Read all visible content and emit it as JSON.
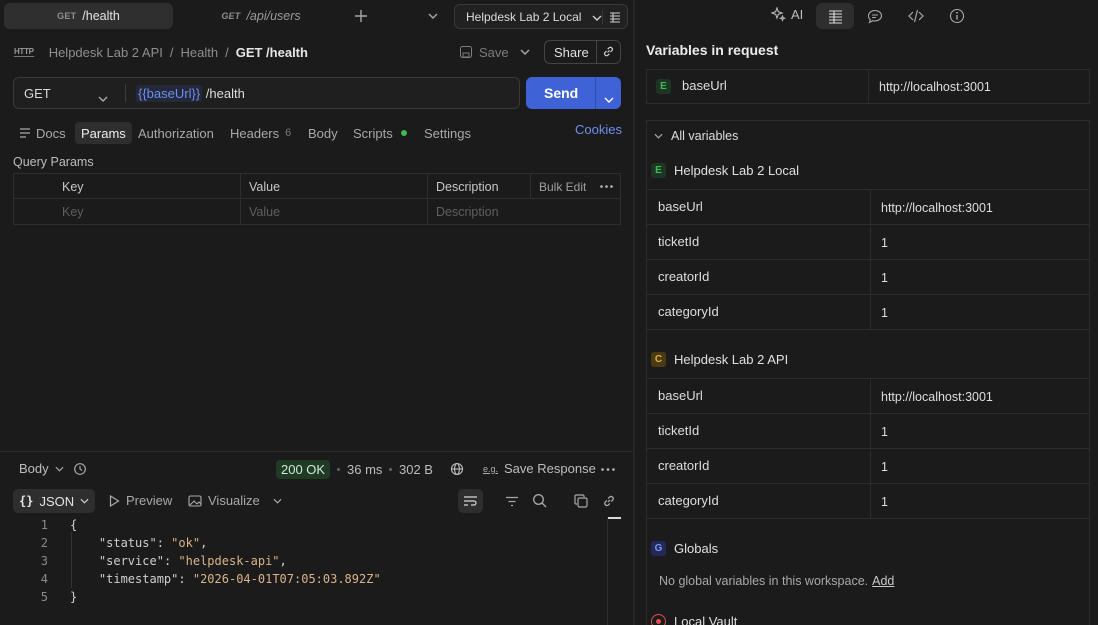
{
  "tabs": [
    {
      "method": "GET",
      "label": "GET /health",
      "active": true
    },
    {
      "method": "GET",
      "label": "GET /api/users",
      "active": false
    }
  ],
  "environment": {
    "selected": "Helpdesk Lab 2 Local"
  },
  "right_toolbar": {
    "ai_label": "AI"
  },
  "breadcrumb": {
    "collection": "Helpdesk Lab 2 API",
    "folder": "Health",
    "request": "GET /health"
  },
  "actions": {
    "save_label": "Save",
    "share_label": "Share"
  },
  "request": {
    "method": "GET",
    "url_variable": "{{baseUrl}}",
    "url_path": " /health",
    "send_label": "Send"
  },
  "request_tabs": [
    {
      "label": "Docs",
      "active": false
    },
    {
      "label": "Params",
      "active": true
    },
    {
      "label": "Authorization",
      "active": false
    },
    {
      "label": "Headers",
      "count": "6",
      "active": false
    },
    {
      "label": "Body",
      "active": false
    },
    {
      "label": "Scripts",
      "active": false
    },
    {
      "label": "Settings",
      "active": false
    }
  ],
  "cookies_label": "Cookies",
  "query_params": {
    "title": "Query Params",
    "headers": {
      "key": "Key",
      "value": "Value",
      "description": "Description",
      "bulk_edit": "Bulk Edit"
    },
    "placeholders": {
      "key": "Key",
      "value": "Value",
      "description": "Description"
    }
  },
  "response": {
    "body_label": "Body",
    "status": "200 OK",
    "time": "36 ms",
    "size": "302 B",
    "save_response_label": "Save Response",
    "format_label": "JSON",
    "preview_label": "Preview",
    "visualize_label": "Visualize",
    "lines": [
      {
        "n": "1",
        "text": "{"
      },
      {
        "n": "2",
        "key": "\"status\"",
        "value": "\"ok\"",
        "trail": ","
      },
      {
        "n": "3",
        "key": "\"service\"",
        "value": "\"helpdesk-api\"",
        "trail": ","
      },
      {
        "n": "4",
        "key": "\"timestamp\"",
        "value": "\"2026-04-01T07:05:03.892Z\"",
        "trail": ""
      },
      {
        "n": "5",
        "text": "}"
      }
    ]
  },
  "variables_panel": {
    "title": "Variables in request",
    "request_var": {
      "badge": "E",
      "name": "baseUrl",
      "value": "http://localhost:3001"
    },
    "all_variables_label": "All variables",
    "groups": [
      {
        "badge": "E",
        "name": "Helpdesk Lab 2 Local",
        "vars": [
          {
            "name": "baseUrl",
            "value": "http://localhost:3001"
          },
          {
            "name": "ticketId",
            "value": "1"
          },
          {
            "name": "creatorId",
            "value": "1"
          },
          {
            "name": "categoryId",
            "value": "1"
          }
        ]
      },
      {
        "badge": "C",
        "name": "Helpdesk Lab 2 API",
        "vars": [
          {
            "name": "baseUrl",
            "value": "http://localhost:3001"
          },
          {
            "name": "ticketId",
            "value": "1"
          },
          {
            "name": "creatorId",
            "value": "1"
          },
          {
            "name": "categoryId",
            "value": "1"
          }
        ]
      }
    ],
    "globals": {
      "badge": "G",
      "name": "Globals",
      "empty_text": "No global variables in this workspace.",
      "add_label": "Add"
    },
    "vault": {
      "name": "Local Vault"
    }
  },
  "colors": {
    "accent": "#3f63d6",
    "env_badge": "#3fb950",
    "collection_badge": "#b8860b",
    "globals_badge": "#5b7cf0",
    "status_ok": "#3fb950"
  }
}
